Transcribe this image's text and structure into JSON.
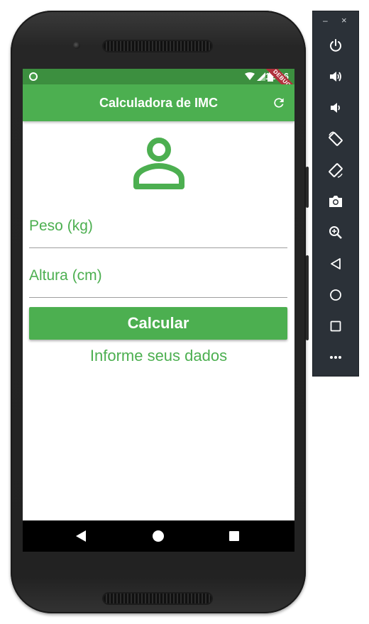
{
  "status_bar": {
    "time": "12:46",
    "debug_label": "DEBUG"
  },
  "app_bar": {
    "title": "Calculadora de IMC",
    "refresh_icon": "refresh-icon"
  },
  "form": {
    "peso_placeholder": "Peso (kg)",
    "altura_placeholder": "Altura (cm)",
    "calcular_label": "Calcular",
    "info_text": "Informe seus dados"
  },
  "nav_bar": {
    "items": [
      "back-icon",
      "home-icon",
      "recents-icon"
    ]
  },
  "emulator_toolbar": {
    "minimize": "–",
    "close": "×",
    "items": [
      "power-icon",
      "volume-up-icon",
      "volume-down-icon",
      "rotate-left-icon",
      "rotate-right-icon",
      "camera-icon",
      "zoom-icon",
      "back-icon",
      "home-icon",
      "overview-icon",
      "more-icon"
    ]
  },
  "colors": {
    "primary": "#4caf50",
    "status_bar": "#3c8f3f",
    "debug_ribbon": "#b0323c",
    "toolbar_bg": "#2b3138"
  }
}
